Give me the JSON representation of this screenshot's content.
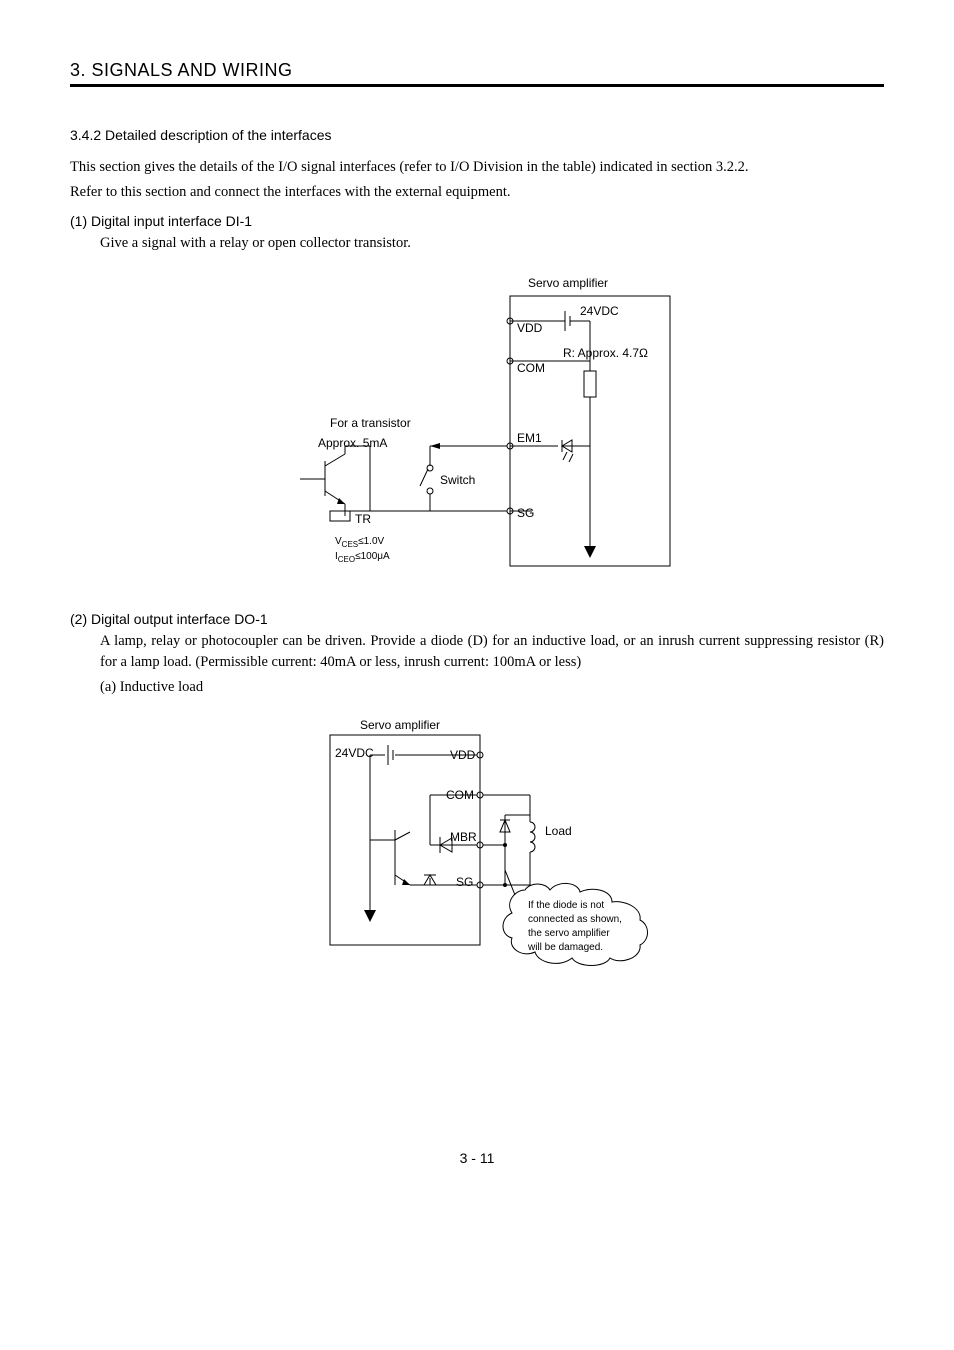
{
  "chapter": "3. SIGNALS AND WIRING",
  "section_head": "3.4.2 Detailed description of the interfaces",
  "intro_p1": "This section gives the details of the I/O signal interfaces (refer to I/O Division in the table) indicated in section 3.2.2.",
  "intro_p2": "Refer to this section and connect the interfaces with the external equipment.",
  "sub1_head": "(1) Digital input interface DI-1",
  "sub1_text": "Give a signal with a relay or open collector transistor.",
  "sub2_head": "(2) Digital output interface DO-1",
  "sub2_text": "A lamp, relay or photocoupler can be driven. Provide a diode (D) for an inductive load, or an inrush current suppressing resistor (R) for a lamp load. (Permissible current: 40mA or less, inrush current: 100mA or less)",
  "sub2a": "(a) Inductive load",
  "d1": {
    "servo_amp": "Servo amplifier",
    "vdd": "VDD",
    "v24": "24VDC",
    "com": "COM",
    "r_approx": "R: Approx. 4.7Ω",
    "for_trans": "For a transistor",
    "approx5": "Approx. 5mA",
    "em1": "EM1",
    "switch": "Switch",
    "tr": "TR",
    "sg": "SG",
    "vces_line1_pre": "V",
    "vces_line1_sub": "CES",
    "vces_line1_post": "≤1.0V",
    "iceo_line2_pre": "I",
    "iceo_line2_sub": "CEO",
    "iceo_line2_post": "≤100μA"
  },
  "d2": {
    "servo_amp": "Servo amplifier",
    "v24": "24VDC",
    "vdd": "VDD",
    "com": "COM",
    "mbr": "MBR",
    "sg": "SG",
    "load": "Load",
    "note_l1": "If the diode is not",
    "note_l2": "connected as shown,",
    "note_l3": "the servo amplifier",
    "note_l4": "will be damaged."
  },
  "page_num": "3 -  11"
}
